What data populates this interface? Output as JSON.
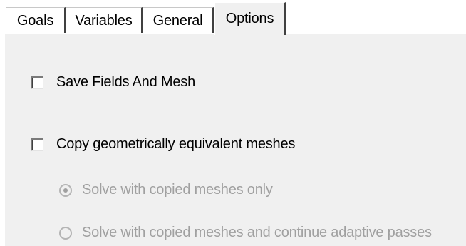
{
  "tabs": [
    {
      "label": "Goals",
      "active": false
    },
    {
      "label": "Variables",
      "active": false
    },
    {
      "label": "General",
      "active": false
    },
    {
      "label": "Options",
      "active": true
    }
  ],
  "options": {
    "save_fields_and_mesh": {
      "label": "Save Fields And Mesh",
      "checked": false
    },
    "copy_equivalent_meshes": {
      "label": "Copy geometrically equivalent meshes",
      "checked": false
    },
    "solve_mode": {
      "enabled": false,
      "selected": 0,
      "choices": [
        {
          "label": "Solve with copied meshes only"
        },
        {
          "label": "Solve with copied meshes and continue adaptive passes"
        }
      ]
    }
  }
}
